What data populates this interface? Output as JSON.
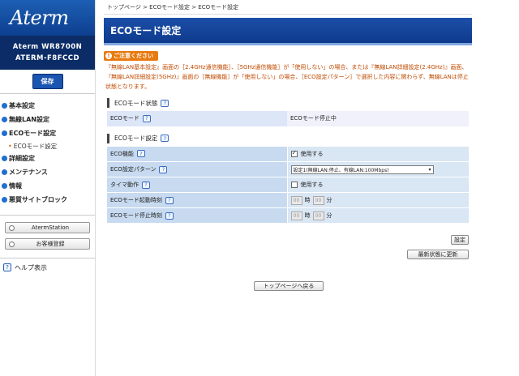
{
  "sidebar": {
    "logo": "Aterm",
    "model_line1": "Aterm  WR8700N",
    "model_line2": "ATERM-F8FCCD",
    "save_label": "保存",
    "nav": [
      {
        "label": "基本設定",
        "type": "main"
      },
      {
        "label": "無線LAN設定",
        "type": "main"
      },
      {
        "label": "ECOモード設定",
        "type": "main"
      },
      {
        "label": "ECOモード設定",
        "type": "sub"
      },
      {
        "label": "詳細設定",
        "type": "main"
      },
      {
        "label": "メンテナンス",
        "type": "main"
      },
      {
        "label": "情報",
        "type": "main"
      },
      {
        "label": "悪質サイトブロック",
        "type": "main"
      }
    ],
    "buttons": [
      "AtermStation",
      "お客様登録"
    ],
    "help_label": "ヘルプ表示"
  },
  "breadcrumb": "トップページ > ECOモード設定 > ECOモード設定",
  "title": "ECOモード設定",
  "notice": {
    "badge": "ご注意ください",
    "text": "『無線LAN基本設定』画面の［2.4GHz通信機能］、［5GHz通信機能］が「使用しない」の場合、または『無線LAN詳細設定(2.4GHz)』画面、『無線LAN詳細設定(5GHz)』画面の［無線機能］が「使用しない」の場合、［ECO設定パターン］で選択した内容に関わらず、無線LANは停止状態となります。"
  },
  "status_section": {
    "heading": "ECOモード状態",
    "rows": [
      {
        "label": "ECOモード",
        "value": "ECOモード停止中"
      }
    ]
  },
  "settings_section": {
    "heading": "ECOモード設定",
    "eco_function_label": "ECO機能",
    "eco_function_value": "使用する",
    "pattern_label": "ECO設定パターン",
    "pattern_value": "設定1(無線LAN:停止、有線LAN:100Mbps)",
    "timer_label": "タイマ動作",
    "timer_value": "使用する",
    "start_label": "ECOモード起動時刻",
    "stop_label": "ECOモード停止時刻",
    "hour_placeholder": "00",
    "minute_placeholder": "00",
    "hour_unit": "時",
    "minute_unit": "分"
  },
  "buttons": {
    "set": "設定",
    "refresh": "最新状態に更新",
    "top": "トップページへ戻る"
  },
  "colors": {
    "header_blue": "#0e3a8c",
    "notice_orange": "#e87a10"
  }
}
